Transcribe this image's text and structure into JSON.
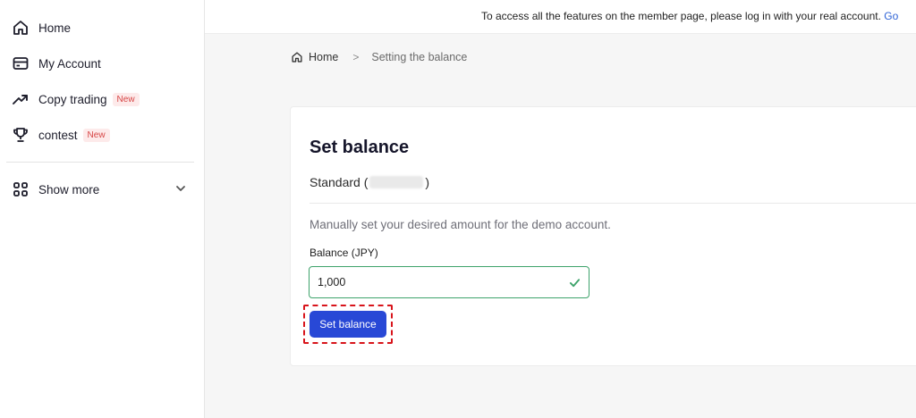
{
  "sidebar": {
    "items": [
      {
        "label": "Home",
        "icon": "home-icon"
      },
      {
        "label": "My Account",
        "icon": "card-icon"
      },
      {
        "label": "Copy trading",
        "icon": "trend-up-icon",
        "badge": "New"
      },
      {
        "label": "contest",
        "icon": "trophy-icon",
        "badge": "New"
      }
    ],
    "show_more": {
      "label": "Show more",
      "icon": "grid-icon"
    }
  },
  "topbar": {
    "message": "To access all the features on the member page, please log in with your real account.",
    "link_text": "Go"
  },
  "breadcrumb": {
    "home": "Home",
    "separator": ">",
    "current": "Setting the balance"
  },
  "card": {
    "title": "Set balance",
    "account_prefix": "Standard (",
    "account_suffix": ")",
    "description": "Manually set your desired amount for the demo account.",
    "field_label": "Balance (JPY)",
    "field_value": "1,000",
    "button_label": "Set balance"
  },
  "colors": {
    "accent": "#2848d6",
    "valid": "#3ea36b",
    "badge_text": "#d64545",
    "highlight": "#d8141b",
    "link": "#2f63d6"
  }
}
